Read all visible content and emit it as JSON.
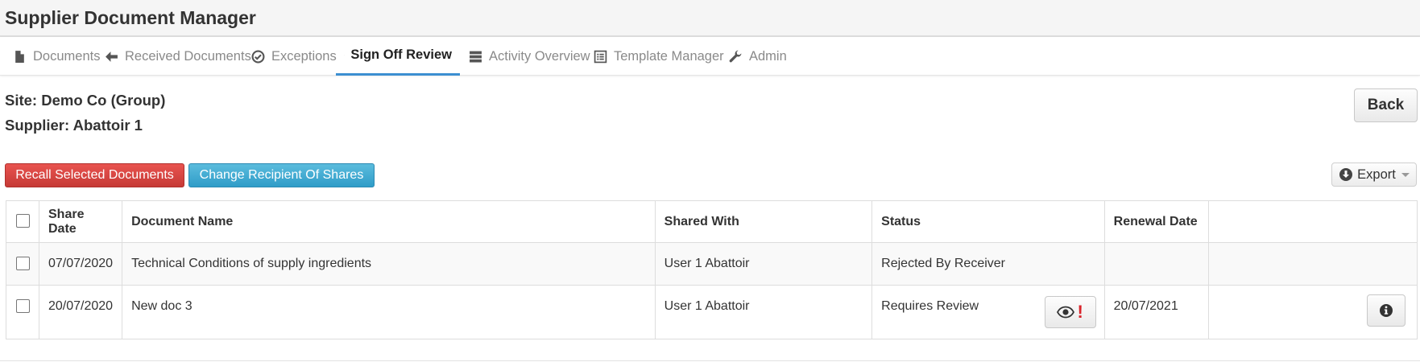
{
  "app": {
    "title": "Supplier Document Manager"
  },
  "nav": {
    "tabs": [
      {
        "label": "Documents",
        "icon": "file-icon",
        "active": false
      },
      {
        "label": "Received Documents",
        "icon": "arrow-left-icon",
        "active": false
      },
      {
        "label": "Exceptions",
        "icon": "check-circle-icon",
        "active": false
      },
      {
        "label": "Sign Off Review",
        "icon": "check-square-icon",
        "active": true
      },
      {
        "label": "Activity Overview",
        "icon": "server-icon",
        "active": false
      },
      {
        "label": "Template Manager",
        "icon": "list-alt-icon",
        "active": false
      },
      {
        "label": "Admin",
        "icon": "wrench-icon",
        "active": false
      }
    ]
  },
  "context": {
    "site": "Site: Demo Co (Group)",
    "supplier": "Supplier: Abattoir 1"
  },
  "actions": {
    "back": "Back",
    "recall": "Recall Selected Documents",
    "change_recipient": "Change Recipient Of Shares",
    "export": "Export"
  },
  "table": {
    "headers": {
      "share_date": "Share Date",
      "document_name": "Document Name",
      "shared_with": "Shared With",
      "status": "Status",
      "renewal_date": "Renewal Date"
    },
    "rows": [
      {
        "share_date": "07/07/2020",
        "document_name": "Technical Conditions of supply ingredients",
        "shared_with": "User 1 Abattoir",
        "status": "Rejected By Receiver",
        "renewal_date": ""
      },
      {
        "share_date": "20/07/2020",
        "document_name": "New doc 3",
        "shared_with": "User 1 Abattoir",
        "status": "Requires Review",
        "renewal_date": "20/07/2021"
      }
    ]
  },
  "colors": {
    "active_tab_underline": "#3c8fd1",
    "danger_button": "#d9534f",
    "info_button": "#46b8da",
    "review_alert": "#d9232a"
  }
}
